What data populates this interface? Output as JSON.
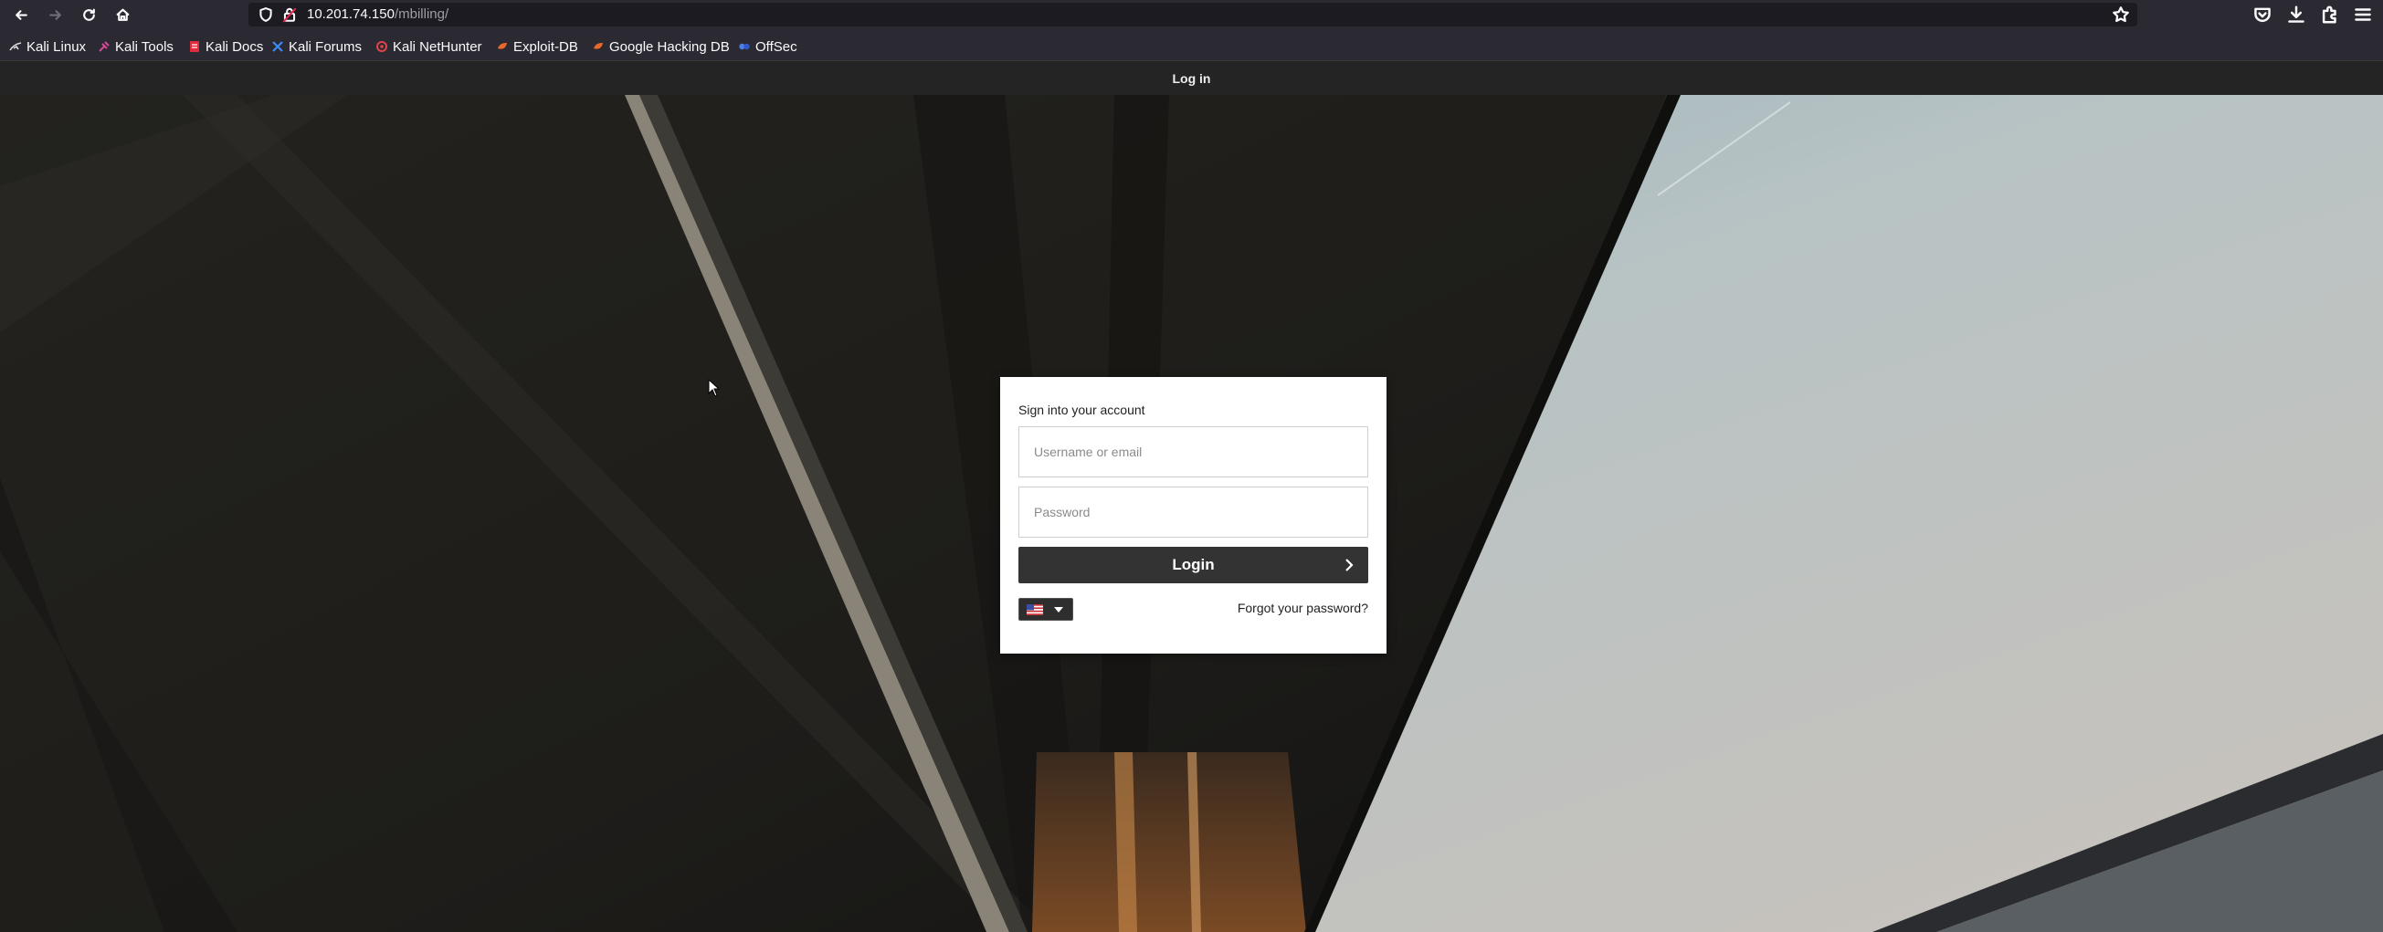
{
  "browser": {
    "url_host": "10.201.74.150",
    "url_path": "/mbilling/",
    "bookmarks": [
      {
        "label": "Kali Linux",
        "icon": "kali-dragon-icon"
      },
      {
        "label": "Kali Tools",
        "icon": "kali-tools-icon"
      },
      {
        "label": "Kali Docs",
        "icon": "kali-docs-icon"
      },
      {
        "label": "Kali Forums",
        "icon": "kali-forums-icon"
      },
      {
        "label": "Kali NetHunter",
        "icon": "nethunter-icon"
      },
      {
        "label": "Exploit-DB",
        "icon": "exploit-db-icon"
      },
      {
        "label": "Google Hacking DB",
        "icon": "ghdb-icon"
      },
      {
        "label": "OffSec",
        "icon": "offsec-icon"
      }
    ]
  },
  "page": {
    "title": "Log in"
  },
  "login": {
    "heading": "Sign into your account",
    "username_placeholder": "Username or email",
    "password_placeholder": "Password",
    "button_label": "Login",
    "forgot_label": "Forgot your password?",
    "language_flag": "us-flag-icon"
  },
  "colors": {
    "page_bar": "#242424",
    "button": "#333333",
    "card": "#ffffff"
  }
}
